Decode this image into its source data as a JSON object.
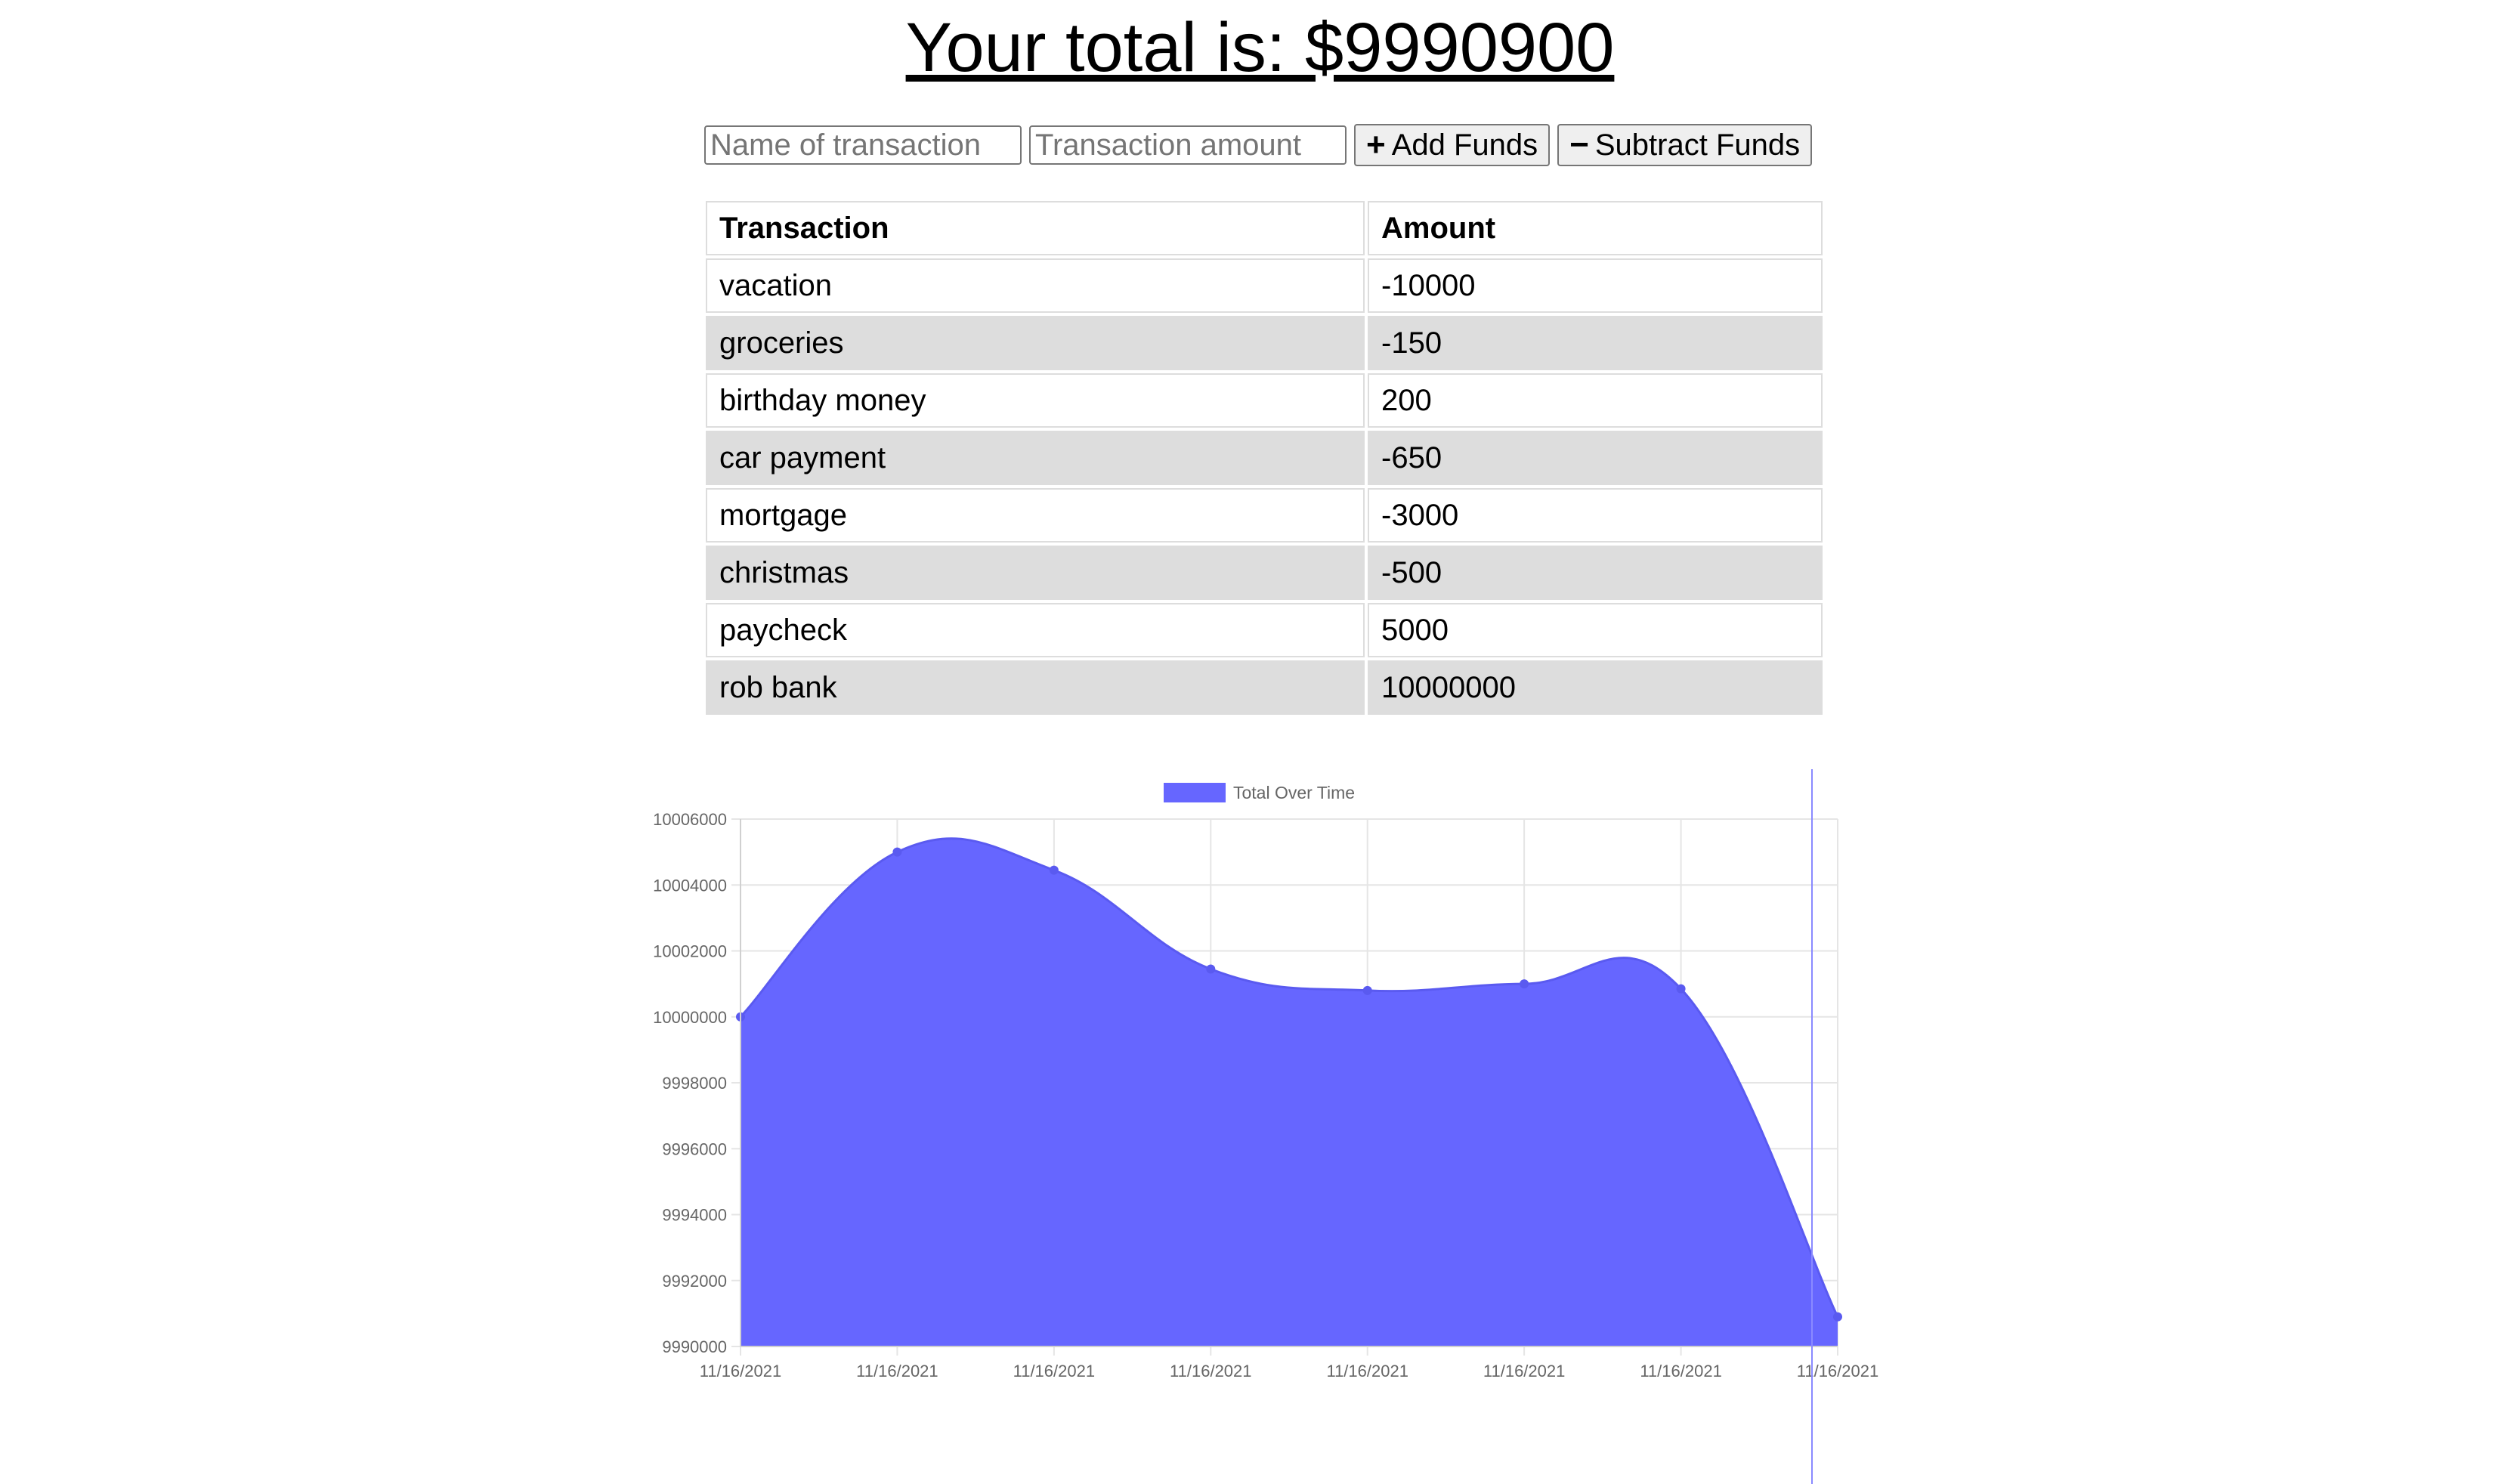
{
  "header": {
    "title": "Your total is: $9990900"
  },
  "form": {
    "name_placeholder": "Name of transaction",
    "amount_placeholder": "Transaction amount",
    "add_label": "Add Funds",
    "subtract_label": "Subtract Funds",
    "add_icon": "plus-icon",
    "subtract_icon": "minus-icon"
  },
  "table": {
    "headers": [
      "Transaction",
      "Amount"
    ],
    "rows": [
      {
        "name": "vacation",
        "amount": "-10000"
      },
      {
        "name": "groceries",
        "amount": "-150"
      },
      {
        "name": "birthday money",
        "amount": "200"
      },
      {
        "name": "car payment",
        "amount": "-650"
      },
      {
        "name": "mortgage",
        "amount": "-3000"
      },
      {
        "name": "christmas",
        "amount": "-500"
      },
      {
        "name": "paycheck",
        "amount": "5000"
      },
      {
        "name": "rob bank",
        "amount": "10000000"
      }
    ]
  },
  "chart_data": {
    "type": "area",
    "title": "",
    "xlabel": "",
    "ylabel": "",
    "legend": {
      "label": "Total Over Time",
      "position": "top"
    },
    "fill_color": "#6666ff",
    "grid": true,
    "ylim": [
      9990000,
      10006000
    ],
    "yticks": [
      "10006000",
      "10004000",
      "10002000",
      "10000000",
      "9998000",
      "9996000",
      "9994000",
      "9992000",
      "9990000"
    ],
    "x": [
      "11/16/2021",
      "11/16/2021",
      "11/16/2021",
      "11/16/2021",
      "11/16/2021",
      "11/16/2021",
      "11/16/2021",
      "11/16/2021"
    ],
    "series": [
      {
        "name": "Total Over Time",
        "values": [
          10000000,
          10005000,
          10004450,
          10001450,
          10000800,
          10001000,
          10000850,
          9990900
        ]
      }
    ]
  }
}
